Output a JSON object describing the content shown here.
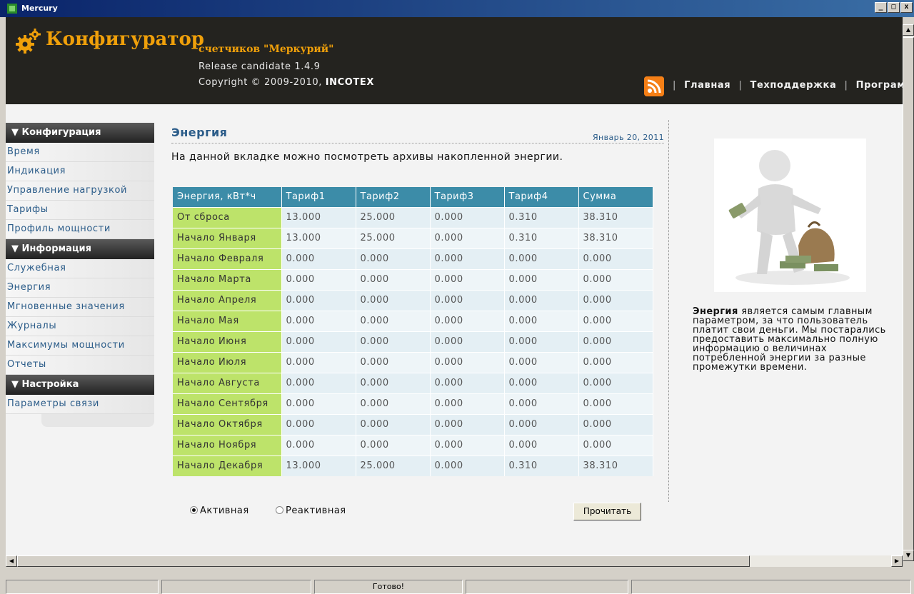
{
  "window": {
    "title": "Mercury",
    "controls": {
      "minimize": "_",
      "maximize": "□",
      "close": "x"
    }
  },
  "header": {
    "brand": "Конфигуратор",
    "brand_sub": "счетчиков \"Меркурий\"",
    "release": "Release candidate 1.4.9",
    "copyright_prefix": "Copyright © 2009-2010,",
    "copyright_company": "INCOTEX",
    "nav": [
      "Главная",
      "Техподдержка",
      "Программа"
    ],
    "nav_separator": "|",
    "icons": {
      "logo": "gear-icon",
      "feed": "rss-icon"
    }
  },
  "sidebar": {
    "sections": [
      {
        "title": "▼ Конфигурация",
        "items": [
          "Время",
          "Индикация",
          "Управление нагрузкой",
          "Тарифы",
          "Профиль мощности"
        ]
      },
      {
        "title": "▼ Информация",
        "items": [
          "Служебная",
          "Энергия",
          "Мгновенные значения",
          "Журналы",
          "Максимумы мощности",
          "Отчеты"
        ]
      },
      {
        "title": "▼ Настройка",
        "items": [
          "Параметры связи"
        ]
      }
    ]
  },
  "main": {
    "title": "Энергия",
    "date": "Январь 20, 2011",
    "intro": "На данной вкладке можно посмотреть архивы накопленной энергии.",
    "table": {
      "headers": [
        "Энергия, кВт*ч",
        "Тариф1",
        "Тариф2",
        "Тариф3",
        "Тариф4",
        "Сумма"
      ],
      "rows": [
        [
          "От сброса",
          "13.000",
          "25.000",
          "0.000",
          "0.310",
          "38.310"
        ],
        [
          "Начало Января",
          "13.000",
          "25.000",
          "0.000",
          "0.310",
          "38.310"
        ],
        [
          "Начало Февраля",
          "0.000",
          "0.000",
          "0.000",
          "0.000",
          "0.000"
        ],
        [
          "Начало Марта",
          "0.000",
          "0.000",
          "0.000",
          "0.000",
          "0.000"
        ],
        [
          "Начало Апреля",
          "0.000",
          "0.000",
          "0.000",
          "0.000",
          "0.000"
        ],
        [
          "Начало Мая",
          "0.000",
          "0.000",
          "0.000",
          "0.000",
          "0.000"
        ],
        [
          "Начало Июня",
          "0.000",
          "0.000",
          "0.000",
          "0.000",
          "0.000"
        ],
        [
          "Начало Июля",
          "0.000",
          "0.000",
          "0.000",
          "0.000",
          "0.000"
        ],
        [
          "Начало Августа",
          "0.000",
          "0.000",
          "0.000",
          "0.000",
          "0.000"
        ],
        [
          "Начало Сентября",
          "0.000",
          "0.000",
          "0.000",
          "0.000",
          "0.000"
        ],
        [
          "Начало Октября",
          "0.000",
          "0.000",
          "0.000",
          "0.000",
          "0.000"
        ],
        [
          "Начало Ноября",
          "0.000",
          "0.000",
          "0.000",
          "0.000",
          "0.000"
        ],
        [
          "Начало Декабря",
          "13.000",
          "25.000",
          "0.000",
          "0.310",
          "38.310"
        ]
      ]
    },
    "radio_active": "Активная",
    "radio_reactive": "Реактивная",
    "selected_mode": "Активная",
    "read_button": "Прочитать"
  },
  "aside": {
    "illustration": "money-man-illustration",
    "bold_word": "Энергия",
    "text": " является самым главным параметром, за что пользователь платит свои деньги. Мы постарались предоставить максимально полную информацию о величинах потребленной энергии за разные промежутки времени."
  },
  "statusbar": {
    "cells": [
      "",
      "",
      "Готово!",
      "",
      ""
    ]
  },
  "colors": {
    "header_bg": "#24231f",
    "brand": "#f0a00a",
    "link": "#2b5c89",
    "table_header": "#3c8ca8",
    "row_header": "#bde36a",
    "cell": "#e4eff4"
  }
}
